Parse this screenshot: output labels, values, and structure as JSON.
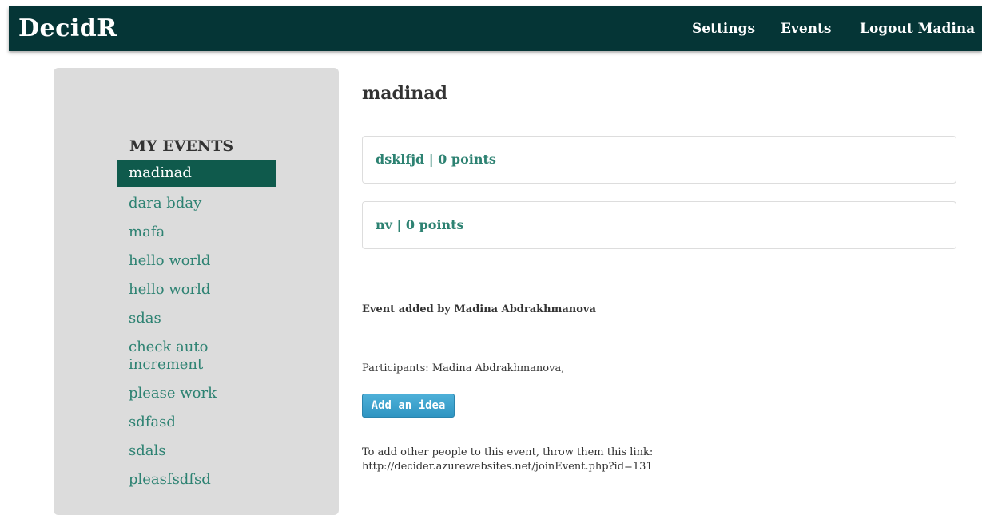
{
  "navbar": {
    "brand": "DecidR",
    "links": [
      "Settings",
      "Events",
      "Logout Madina"
    ]
  },
  "sidebar": {
    "heading": "MY EVENTS",
    "items": [
      "madinad",
      "dara bday",
      "mafa",
      "hello world",
      "hello world",
      "sdas",
      "check auto increment",
      "please work",
      "sdfasd",
      "sdals",
      "pleasfsdfsd"
    ],
    "active_index": 0
  },
  "main": {
    "title": "madinad",
    "ideas": [
      "dsklfjd | 0 points",
      "nv | 0 points"
    ],
    "added_by": "Event added by Madina Abdrakhmanova",
    "participants_label": "Participants:",
    "participants": "Madina Abdrakhmanova,",
    "add_idea_label": "Add an idea",
    "invite_text": "To add other people to this event, throw them this link:",
    "invite_link": "http://decider.azurewebsites.net/joinEvent.php?id=131"
  },
  "colors": {
    "navbar_bg": "#053536",
    "accent_text": "#2d8272",
    "active_item_bg": "#0f5a4c",
    "sidebar_bg": "#dcdcdc",
    "button_bg": "#3aa0cb"
  }
}
